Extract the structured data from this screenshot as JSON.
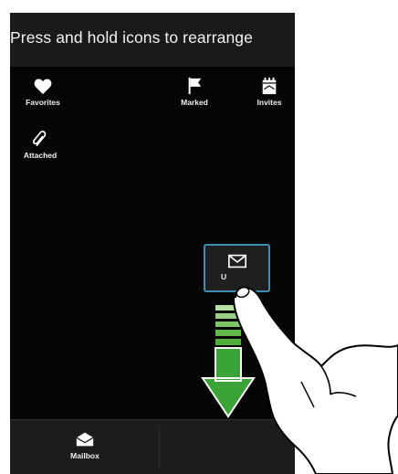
{
  "header": {
    "title": "Press and hold icons to rearrange"
  },
  "tiles": [
    {
      "label": "Favorites",
      "icon": "heart-icon"
    },
    {
      "label": "Marked",
      "icon": "flag-icon"
    },
    {
      "label": "Invites",
      "icon": "calendar-invite-icon"
    },
    {
      "label": "Attached",
      "icon": "paperclip-icon"
    }
  ],
  "drag_tile": {
    "label": "U",
    "icon": "envelope-icon",
    "border_color": "#3c8fb4"
  },
  "bottom_bar": {
    "tab_label": "Mailbox",
    "icon": "envelope-open-icon"
  },
  "gesture": {
    "arrow_color": "#3aa335",
    "hand_icon": "pointing-hand-icon",
    "direction": "down"
  }
}
